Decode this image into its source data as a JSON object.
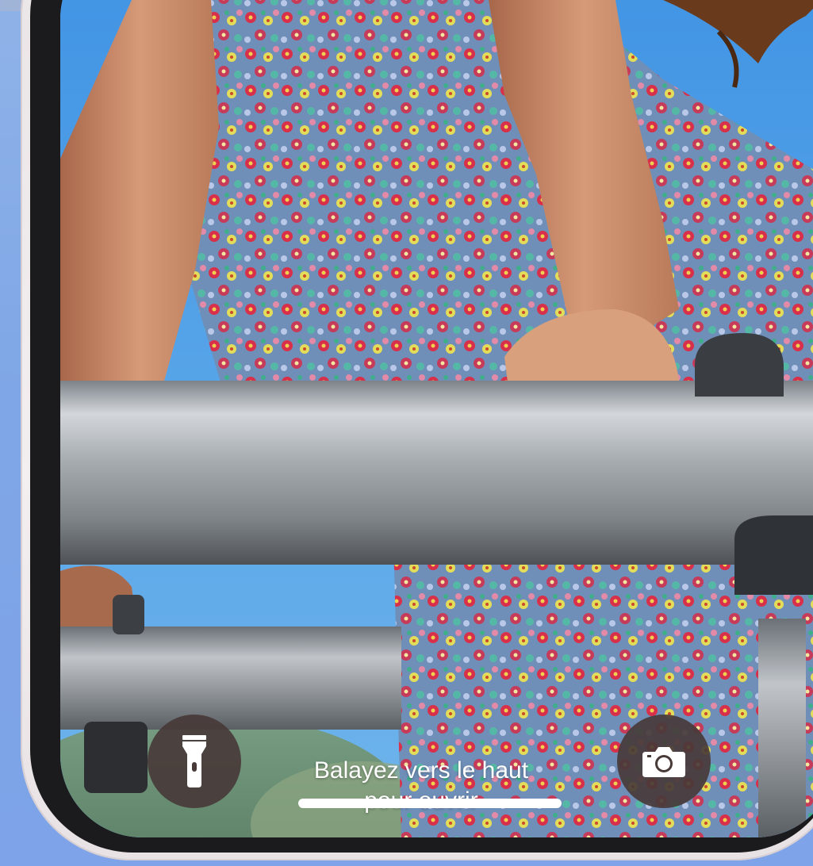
{
  "lockscreen": {
    "unlock_hint_line1": "Balayez vers le haut",
    "unlock_hint_line2": "pour ouvrir",
    "flashlight_icon": "flashlight-icon",
    "camera_icon": "camera-icon"
  },
  "colors": {
    "button_bg": "#483a38",
    "text": "#ffffff",
    "sky": "#5aa0e0"
  }
}
